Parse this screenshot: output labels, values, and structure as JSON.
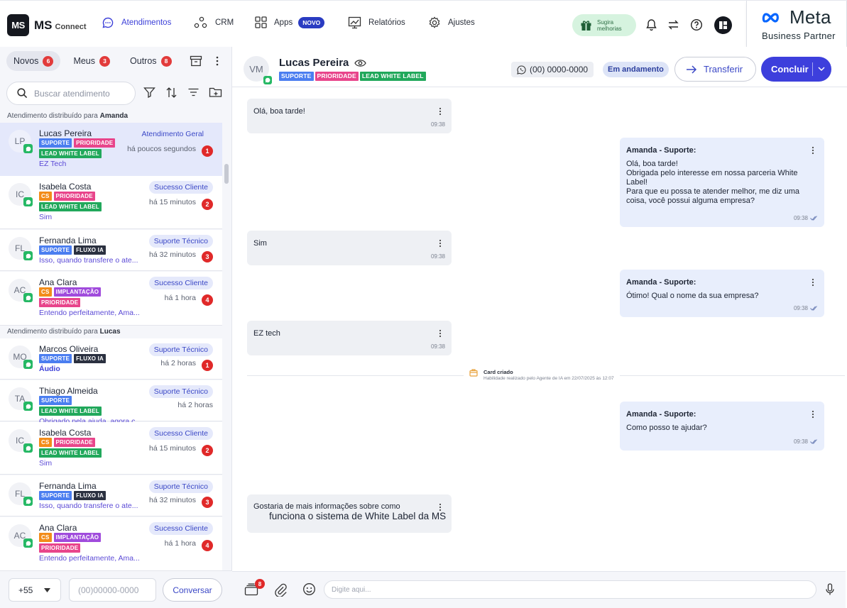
{
  "brand": {
    "logo": "MS",
    "name": "MS",
    "sub": "Connect"
  },
  "nav": {
    "atendimentos": "Atendimentos",
    "crm": "CRM",
    "apps": "Apps",
    "apps_badge": "NOVO",
    "relatorios": "Relatórios",
    "ajustes": "Ajustes"
  },
  "suggest": {
    "line1": "Sugira",
    "line2": "melhorias"
  },
  "meta": {
    "word": "Meta",
    "sub": "Business Partner"
  },
  "tabs": [
    {
      "label": "Novos",
      "count": "6"
    },
    {
      "label": "Meus",
      "count": "3"
    },
    {
      "label": "Outros",
      "count": "8"
    }
  ],
  "search": {
    "placeholder": "Buscar atendimento"
  },
  "groups": [
    {
      "prefix": "Atendimento distribuído para ",
      "name": "Amanda"
    },
    {
      "prefix": "Atendimento distribuído para ",
      "name": "Lucas"
    }
  ],
  "items": [
    {
      "initials": "LP",
      "name": "Lucas Pereira",
      "tags": [
        "SUPORTE",
        "PRIORIDADE",
        "LEAD WHITE LABEL"
      ],
      "preview": "EZ Tech",
      "dept": "Atendimento Geral",
      "time": "há poucos segundos",
      "unread": "1"
    },
    {
      "initials": "IC",
      "name": "Isabela Costa",
      "tags": [
        "CS",
        "PRIORIDADE",
        "LEAD WHITE LABEL"
      ],
      "preview": "Sim",
      "dept": "Sucesso Cliente",
      "time": "há 15 minutos",
      "unread": "2"
    },
    {
      "initials": "FL",
      "name": "Fernanda Lima",
      "tags": [
        "SUPORTE",
        "FLUXO IA"
      ],
      "preview": "Isso, quando transfere o ate...",
      "dept": "Suporte Técnico",
      "time": "há 32 minutos",
      "unread": "3"
    },
    {
      "initials": "AC",
      "name": "Ana Clara",
      "tags": [
        "CS",
        "IMPLANTAÇÃO",
        "PRIORIDADE"
      ],
      "preview": "Entendo perfeitamente, Ama...",
      "dept": "Sucesso Cliente",
      "time": "há 1 hora",
      "unread": "4"
    },
    {
      "initials": "MO",
      "name": "Marcos Oliveira",
      "tags": [
        "SUPORTE",
        "FLUXO IA"
      ],
      "preview": "Áudio",
      "dept": "Suporte Técnico",
      "time": "há 2 horas",
      "unread": "1"
    },
    {
      "initials": "TA",
      "name": "Thiago Almeida",
      "tags": [
        "SUPORTE",
        "LEAD WHITE LABEL"
      ],
      "preview": "Obrigado pela ajuda, agora c...",
      "dept": "Suporte Técnico",
      "time": "há 2 horas",
      "unread": ""
    },
    {
      "initials": "IC",
      "name": "Isabela Costa",
      "tags": [
        "CS",
        "PRIORIDADE",
        "LEAD WHITE LABEL"
      ],
      "preview": "Sim",
      "dept": "Sucesso Cliente",
      "time": "há 15 minutos",
      "unread": "2"
    },
    {
      "initials": "FL",
      "name": "Fernanda Lima",
      "tags": [
        "SUPORTE",
        "FLUXO IA"
      ],
      "preview": "Isso, quando transfere o ate...",
      "dept": "Suporte Técnico",
      "time": "há 32 minutos",
      "unread": "3"
    },
    {
      "initials": "AC",
      "name": "Ana Clara",
      "tags": [
        "CS",
        "IMPLANTAÇÃO",
        "PRIORIDADE"
      ],
      "preview": "Entendo perfeitamente, Ama...",
      "dept": "Sucesso Cliente",
      "time": "há 1 hora",
      "unread": "4"
    }
  ],
  "footer_left": {
    "ddi": "+55",
    "phone_placeholder": "(00)00000-0000",
    "button": "Conversar"
  },
  "chat": {
    "initials": "VM",
    "name": "Lucas Pereira",
    "tags": [
      "SUPORTE",
      "PRIORIDADE",
      "LEAD WHITE LABEL"
    ],
    "phone": "(00) 0000-0000",
    "status": "Em andamento",
    "transfer": "Transferir",
    "conclude": "Concluir",
    "messages": [
      {
        "dir": "in",
        "text": "Olá, boa tarde!",
        "time": "09:38"
      },
      {
        "dir": "out",
        "sender": "Amanda - Suporte:",
        "text": "Olá, boa tarde!\nObrigada pelo interesse em nossa parceria White\nLabel!\nPara que eu possa te atender melhor, me diz uma\ncoisa, você possui alguma empresa?",
        "time": "09:38"
      },
      {
        "dir": "in",
        "text": "Sim",
        "time": "09:38"
      },
      {
        "dir": "out",
        "sender": "Amanda - Suporte:",
        "text": "Ótimo! Qual o nome da sua empresa?",
        "time": "09:38"
      },
      {
        "dir": "in",
        "text": "EZ tech",
        "time": "09:38"
      },
      {
        "dir": "out",
        "sender": "Amanda - Suporte:",
        "text": "Como posso te ajudar?",
        "time": "09:38"
      }
    ],
    "system": {
      "title": "Card criado",
      "detail": "Habilidade realizado pelo Agente de IA em 22/07/2025 às 12:07"
    },
    "pending": {
      "line1": "Gostaria de mais informações sobre como",
      "line2": "funciona o sistema de White Label da MS"
    },
    "attach_badge": "8",
    "input_placeholder": "Digite aqui..."
  },
  "colors": {
    "accent": "#3d3fdc",
    "badge": "#e02929",
    "whatsapp": "#25b864"
  }
}
